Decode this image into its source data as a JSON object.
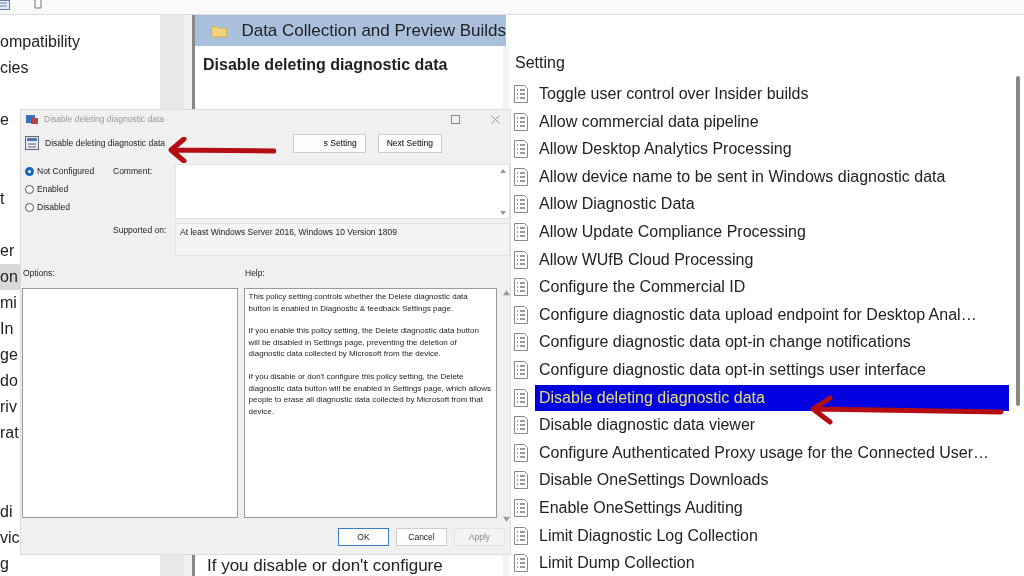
{
  "tree": {
    "items": [
      {
        "label": "ompatibility",
        "selected": false
      },
      {
        "label": "cies",
        "selected": false
      },
      {
        "label": "e",
        "selected": false
      },
      {
        "label": "t",
        "selected": false
      },
      {
        "label": "er",
        "selected": false
      },
      {
        "label": "on",
        "selected": true
      },
      {
        "label": "mi",
        "selected": false
      },
      {
        "label": "In",
        "selected": false
      },
      {
        "label": "ge",
        "selected": false
      },
      {
        "label": "do",
        "selected": false
      },
      {
        "label": "riv",
        "selected": false
      },
      {
        "label": "rat",
        "selected": false
      },
      {
        "label": "di",
        "selected": false
      },
      {
        "label": "vic",
        "selected": false
      },
      {
        "label": "g",
        "selected": false
      }
    ]
  },
  "details": {
    "header": "Data Collection and Preview Builds",
    "title": "Disable deleting diagnostic data",
    "description": "If you disable or don't configure"
  },
  "settings": {
    "column": "Setting",
    "rows": [
      {
        "label": "Toggle user control over Insider builds",
        "selected": false
      },
      {
        "label": "Allow commercial data pipeline",
        "selected": false
      },
      {
        "label": "Allow Desktop Analytics Processing",
        "selected": false
      },
      {
        "label": "Allow device name to be sent in Windows diagnostic data",
        "selected": false
      },
      {
        "label": "Allow Diagnostic Data",
        "selected": false
      },
      {
        "label": "Allow Update Compliance Processing",
        "selected": false
      },
      {
        "label": "Allow WUfB Cloud Processing",
        "selected": false
      },
      {
        "label": "Configure the Commercial ID",
        "selected": false
      },
      {
        "label": "Configure diagnostic data upload endpoint for Desktop Anal…",
        "selected": false
      },
      {
        "label": "Configure diagnostic data opt-in change notifications",
        "selected": false
      },
      {
        "label": "Configure diagnostic data opt-in settings user interface",
        "selected": false
      },
      {
        "label": "Disable deleting diagnostic data",
        "selected": true
      },
      {
        "label": "Disable diagnostic data viewer",
        "selected": false
      },
      {
        "label": "Configure Authenticated Proxy usage for the Connected User…",
        "selected": false
      },
      {
        "label": "Disable OneSettings Downloads",
        "selected": false
      },
      {
        "label": "Enable OneSettings Auditing",
        "selected": false
      },
      {
        "label": "Limit Diagnostic Log Collection",
        "selected": false
      },
      {
        "label": "Limit Dump Collection",
        "selected": false
      }
    ]
  },
  "dialog": {
    "title": "Disable deleting diagnostic data",
    "policy_name": "Disable deleting diagnostic data",
    "nav_buttons": [
      "s Setting",
      "Next Setting"
    ],
    "options": [
      {
        "label": "Not Configured",
        "selected": true
      },
      {
        "label": "Enabled",
        "selected": false
      },
      {
        "label": "Disabled",
        "selected": false
      }
    ],
    "comment_label": "Comment:",
    "supported_label": "Supported on:",
    "supported_value": "At least Windows Server 2016, Windows 10 Version 1809",
    "options_label": "Options:",
    "help_label": "Help:",
    "help": [
      "This policy setting controls whether the Delete diagnostic data button is enabled in Diagnostic & feedback Settings page.",
      "If you enable this policy setting, the Delete diagnostic data button will be disabled in Settings page, preventing the deletion of diagnostic data collected by Microsoft from the device.",
      "If you disable or don't configure this policy setting, the Delete diagnostic data button will be enabled in Settings page, which allows people to erase all diagnostic data collected by Microsoft from that device."
    ],
    "buttons": [
      {
        "label": "OK",
        "kind": "default",
        "disabled": false
      },
      {
        "label": "Cancel",
        "kind": "normal",
        "disabled": false
      },
      {
        "label": "Apply",
        "kind": "normal",
        "disabled": true
      }
    ]
  }
}
